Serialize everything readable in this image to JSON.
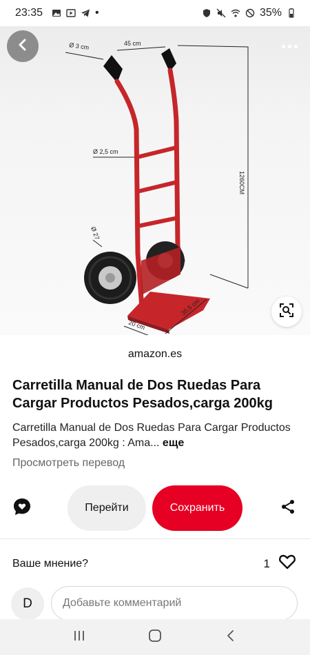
{
  "status_bar": {
    "time": "23:35",
    "dot": "•",
    "battery": "35%",
    "icons_left": [
      "gallery-icon",
      "play-icon",
      "telegram-icon"
    ],
    "icons_right": [
      "shield-icon",
      "mute-icon",
      "wifi-icon",
      "dnd-icon",
      "battery-icon"
    ]
  },
  "hero": {
    "dimension_labels": {
      "handle_diameter": "Ø 3 cm",
      "top_width": "45 cm",
      "frame_diameter": "Ø 2,5 cm",
      "height": "1260CM",
      "wheel_diameter": "Ø 27",
      "plate_depth": "20 cm",
      "plate_width": "35,5 cm"
    },
    "icons": [
      "back-arrow-icon",
      "more-dots-icon",
      "visual-search-icon"
    ]
  },
  "pin": {
    "source": "amazon.es",
    "title": "Carretilla Manual de Dos Ruedas Para Cargar Productos Pesados,carga 200kg",
    "description": "Carretilla Manual de Dos Ruedas Para Cargar Productos Pesados,carga 200kg : Ama...",
    "more_label": "еще",
    "translate_label": "Просмотреть перевод"
  },
  "actions": {
    "go_label": "Перейти",
    "save_label": "Сохранить",
    "save_color": "#e60023"
  },
  "feedback": {
    "opinion_label": "Ваше мнение?",
    "like_count": "1"
  },
  "comment": {
    "avatar_initial": "D",
    "placeholder": "Добавьте комментарий"
  },
  "nav": {
    "icons": [
      "recents-icon",
      "home-icon",
      "back-icon"
    ]
  }
}
